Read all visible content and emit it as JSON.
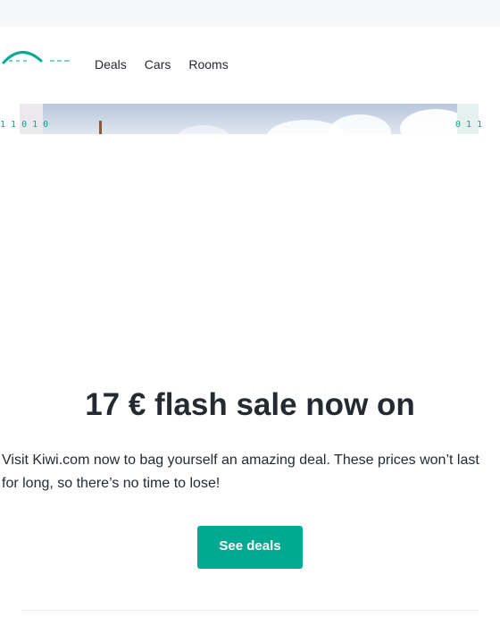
{
  "brand": {
    "name": "kiwi.com",
    "accent_color": "#00a991"
  },
  "nav": {
    "items": [
      "Deals",
      "Cars",
      "Rooms"
    ]
  },
  "hero": {
    "ticker_left": "1 1 0 1 0",
    "ticker_right": "0 1 1"
  },
  "content": {
    "headline": "17 € flash sale now on",
    "body": "Visit Kiwi.com now to bag yourself an amazing deal. These prices won’t last for long, so there’s no time to lose!",
    "cta_label": "See deals"
  }
}
